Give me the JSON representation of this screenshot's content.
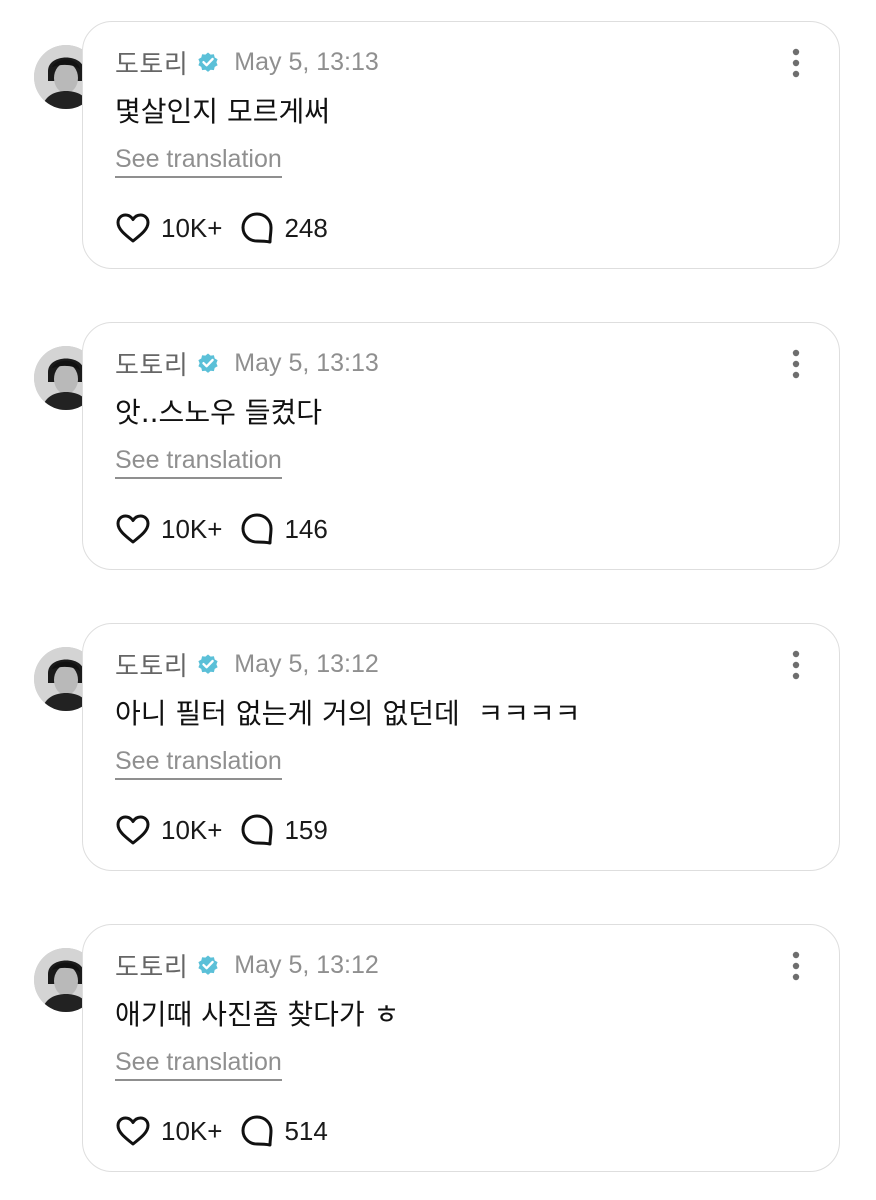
{
  "posts": [
    {
      "username": "도토리",
      "timestamp": "May 5, 13:13",
      "text": "몇살인지 모르게써",
      "translate_label": "See translation",
      "likes": "10K+",
      "replies": "248"
    },
    {
      "username": "도토리",
      "timestamp": "May 5, 13:13",
      "text": "앗..스노우 들켰다",
      "translate_label": "See translation",
      "likes": "10K+",
      "replies": "146"
    },
    {
      "username": "도토리",
      "timestamp": "May 5, 13:12",
      "text": "아니 필터 없는게 거의 없던데  ㅋㅋㅋㅋ",
      "translate_label": "See translation",
      "likes": "10K+",
      "replies": "159"
    },
    {
      "username": "도토리",
      "timestamp": "May 5, 13:12",
      "text": "애기때 사진좀 찾다가 ㅎ",
      "translate_label": "See translation",
      "likes": "10K+",
      "replies": "514"
    }
  ],
  "colors": {
    "verified_badge": "#5bc0d8",
    "card_border": "#dedede",
    "muted_text": "#8f8f8f"
  },
  "icons": {
    "verified": "verified-badge-icon",
    "more": "more-vertical-icon",
    "like": "heart-icon",
    "reply": "comment-bubble-icon"
  }
}
